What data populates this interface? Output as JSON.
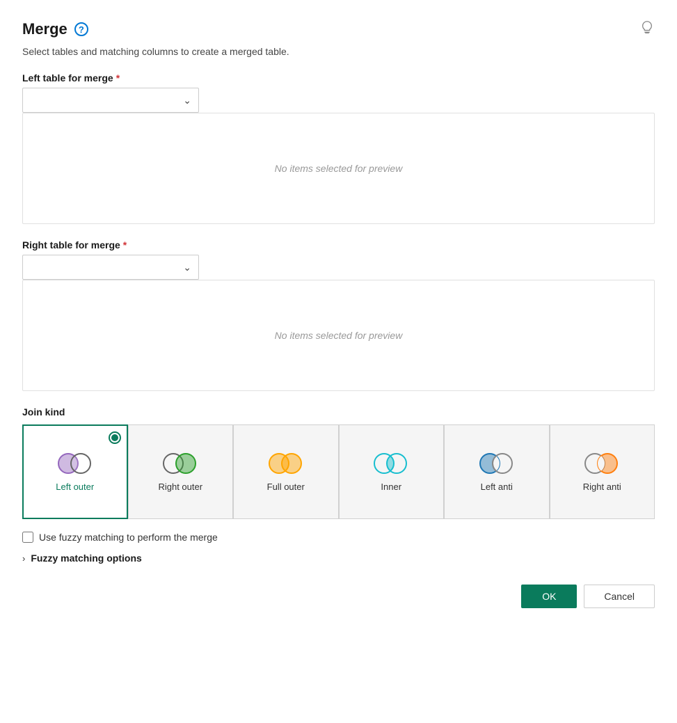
{
  "dialog": {
    "title": "Merge",
    "subtitle": "Select tables and matching columns to create a merged table.",
    "help_icon_label": "?",
    "lightbulb_icon": "💡"
  },
  "left_table": {
    "label": "Left table for merge",
    "required": true,
    "placeholder": "",
    "preview_empty": "No items selected for preview"
  },
  "right_table": {
    "label": "Right table for merge",
    "required": true,
    "placeholder": "",
    "preview_empty": "No items selected for preview"
  },
  "join_kind": {
    "label": "Join kind",
    "options": [
      {
        "id": "left-outer",
        "label": "Left outer",
        "selected": true
      },
      {
        "id": "right-outer",
        "label": "Right outer",
        "selected": false
      },
      {
        "id": "full-outer",
        "label": "Full outer",
        "selected": false
      },
      {
        "id": "inner",
        "label": "Inner",
        "selected": false
      },
      {
        "id": "left-anti",
        "label": "Left anti",
        "selected": false
      },
      {
        "id": "right-anti",
        "label": "Right anti",
        "selected": false
      }
    ]
  },
  "fuzzy": {
    "checkbox_label": "Use fuzzy matching to perform the merge",
    "options_label": "Fuzzy matching options"
  },
  "buttons": {
    "ok_label": "OK",
    "cancel_label": "Cancel"
  }
}
